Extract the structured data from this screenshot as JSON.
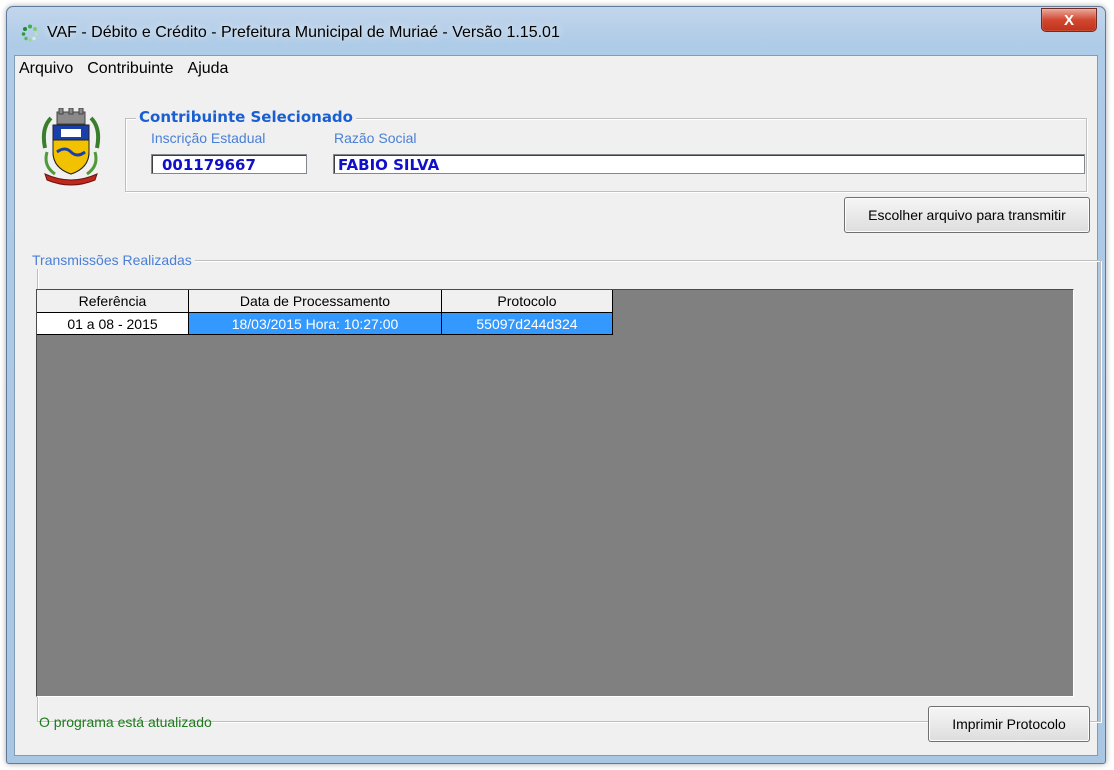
{
  "window": {
    "title": "VAF - Débito e Crédito - Prefeitura Municipal de Muriaé - Versão 1.15.01",
    "close_label": "X"
  },
  "menu": [
    "Arquivo",
    "Contribuinte",
    "Ajuda"
  ],
  "contribuinte": {
    "group_title": "Contribuinte Selecionado",
    "inscricao_label": "Inscrição Estadual",
    "inscricao_value": "001179667",
    "razao_label": "Razão Social",
    "razao_value": "FABIO SILVA"
  },
  "buttons": {
    "choose_file": "Escolher arquivo para transmitir",
    "print_protocol": "Imprimir Protocolo"
  },
  "transmissoes": {
    "group_title": "Transmissões Realizadas",
    "columns": [
      "Referência",
      "Data de Processamento",
      "Protocolo"
    ],
    "rows": [
      [
        "01 a 08 - 2015",
        "18/03/2015 Hora: 10:27:00",
        "55097d244d324"
      ]
    ]
  },
  "status_text": "O programa está atualizado",
  "colors": {
    "highlight": "#3399ff",
    "grid_background": "#808080",
    "status_green": "#1f7a1f",
    "value_blue": "#1010c8"
  }
}
